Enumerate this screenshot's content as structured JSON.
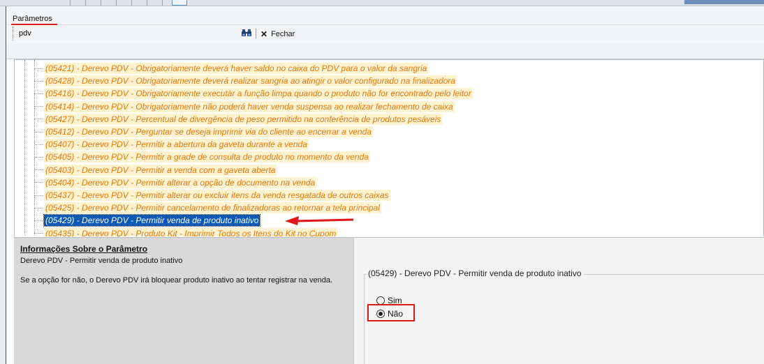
{
  "tab": {
    "label": "Parâmetros"
  },
  "search": {
    "value": "pdv",
    "close_label": "Fechar"
  },
  "tree": {
    "items": [
      "(05421) - Derevo PDV - Obrigatoriamente deverá haver saldo no caixa do PDV para o valor da sangria",
      "(05428) - Derevo PDV - Obrigatoriamente deverá realizar sangria ao atingir o valor configurado na finalizadora",
      "(05416) - Derevo PDV - Obrigatoriamente executar a função limpa quando o produto não for encontrado pelo leitor",
      "(05414) - Derevo PDV - Obrigatoriamente não poderá haver venda suspensa ao realizar fechamento de caixa",
      "(05427) - Derevo PDV - Percentual de divergência de peso permitido na conferência de produtos pesáveis",
      "(05412) - Derevo PDV - Perguntar se deseja imprimir via do cliente ao encerrar a venda",
      "(05407) - Derevo PDV - Permitir a abertura da gaveta durante a venda",
      "(05405) - Derevo PDV - Permitir a grade de consulta de produto no momento da venda",
      "(05403) - Derevo PDV - Permitir a venda com a gaveta aberta",
      "(05404) - Derevo PDV - Permitir alterar a opção de documento na venda",
      "(05437) - Derevo PDV - Permitir alterar ou excluir itens da venda resgatada de outros caixas",
      "(05425) - Derevo PDV - Permitir cancelamento de finalizadoras ao retornar a tela principal",
      "(05429) - Derevo PDV - Permitir venda de produto inativo",
      "(05435) - Derevo PDV - Produto Kit - Imprimir Todos os Itens do Kit no Cupom"
    ],
    "selected_index": 12
  },
  "info": {
    "title": "Informações Sobre o Parâmetro",
    "name": "Derevo PDV - Permitir venda de produto inativo",
    "description": "Se a opção for não, o Derevo PDV irá bloquear produto inativo ao tentar registrar na venda."
  },
  "options": {
    "legend": "(05429) - Derevo PDV - Permitir venda de produto inativo",
    "sim_label": "Sim",
    "nao_label": "Não",
    "selected": "Não"
  },
  "colors": {
    "item_text": "#e8770c",
    "item_bg": "#fff3cf",
    "selected_bg": "#0a58b6",
    "annotation_red": "#e01515"
  },
  "icons": {
    "search": "binoculars-icon",
    "close": "close-icon",
    "annotation": "red-arrow-icon"
  }
}
